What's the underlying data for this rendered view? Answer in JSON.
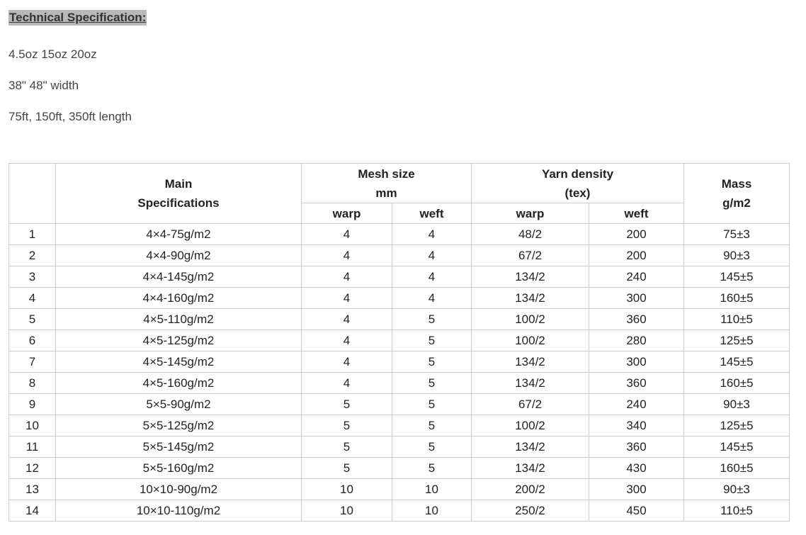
{
  "heading": "Technical Specification:",
  "spec_lines": [
    "4.5oz 15oz 20oz",
    "38\" 48\" width",
    "75ft, 150ft, 350ft length"
  ],
  "table": {
    "headers": {
      "main_line1": "Main",
      "main_line2": "Specifications",
      "mesh_line1": "Mesh size",
      "mesh_line2": "mm",
      "yarn_line1": "Yarn density",
      "yarn_line2": "(tex)",
      "mass_line1": "Mass",
      "mass_line2": "g/m2",
      "warp": "warp",
      "weft": "weft"
    },
    "rows": [
      [
        "1",
        "4×4-75g/m2",
        "4",
        "4",
        "48/2",
        "200",
        "75±3"
      ],
      [
        "2",
        "4×4-90g/m2",
        "4",
        "4",
        "67/2",
        "200",
        "90±3"
      ],
      [
        "3",
        "4×4-145g/m2",
        "4",
        "4",
        "134/2",
        "240",
        "145±5"
      ],
      [
        "4",
        "4×4-160g/m2",
        "4",
        "4",
        "134/2",
        "300",
        "160±5"
      ],
      [
        "5",
        "4×5-110g/m2",
        "4",
        "5",
        "100/2",
        "360",
        "110±5"
      ],
      [
        "6",
        "4×5-125g/m2",
        "4",
        "5",
        "100/2",
        "280",
        "125±5"
      ],
      [
        "7",
        "4×5-145g/m2",
        "4",
        "5",
        "134/2",
        "300",
        "145±5"
      ],
      [
        "8",
        "4×5-160g/m2",
        "4",
        "5",
        "134/2",
        "360",
        "160±5"
      ],
      [
        "9",
        "5×5-90g/m2",
        "5",
        "5",
        "67/2",
        "240",
        "90±3"
      ],
      [
        "10",
        "5×5-125g/m2",
        "5",
        "5",
        "100/2",
        "340",
        "125±5"
      ],
      [
        "11",
        "5×5-145g/m2",
        "5",
        "5",
        "134/2",
        "360",
        "145±5"
      ],
      [
        "12",
        "5×5-160g/m2",
        "5",
        "5",
        "134/2",
        "430",
        "160±5"
      ],
      [
        "13",
        "10×10-90g/m2",
        "10",
        "10",
        "200/2",
        "300",
        "90±3"
      ],
      [
        "14",
        "10×10-110g/m2",
        "10",
        "10",
        "250/2",
        "450",
        "110±5"
      ]
    ]
  }
}
